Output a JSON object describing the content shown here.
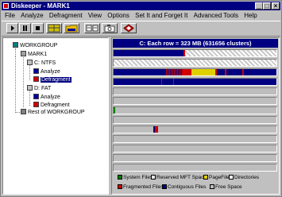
{
  "window": {
    "title": "Diskeeper - MARK1"
  },
  "title_buttons": {
    "minimize": "_",
    "maximize": "□",
    "close": "×"
  },
  "menu": [
    "File",
    "Analyze",
    "Defragment",
    "View",
    "Options",
    "Set It and Forget It",
    "Advanced Tools",
    "Help"
  ],
  "toolbar": {
    "buttons": [
      {
        "name": "play",
        "icon": "play-icon"
      },
      {
        "name": "pause",
        "icon": "pause-icon"
      },
      {
        "name": "stop",
        "icon": "stop-icon"
      },
      {
        "name": "grid",
        "icon": "grid-icon"
      },
      {
        "name": "folder",
        "icon": "folder-icon"
      },
      {
        "name": "volumes",
        "icon": "drives-icon"
      },
      {
        "name": "camera",
        "icon": "camera-icon"
      },
      {
        "name": "help",
        "icon": "diamond-icon"
      }
    ]
  },
  "tree": {
    "workgroup": "WORKGROUP",
    "computer": "MARK1",
    "drive_c": "C: NTFS",
    "c_analyze": "Analyze",
    "c_defragment": "Defragment",
    "drive_d": "D: FAT",
    "d_analyze": "Analyze",
    "d_defragment": "Defragment",
    "rest": "Rest of WORKGROUP"
  },
  "main": {
    "header": "C:  Each row = 323 MB (631656 clusters)"
  },
  "legend": {
    "system_files": "System Files",
    "reserved_mft": "Reserved MFT Space",
    "pagefile": "PageFile",
    "directories": "Directories",
    "fragmented": "Fragmented Files",
    "contiguous": "Contiguous Files",
    "free_space": "Free Space"
  },
  "colors": {
    "system": "#008000",
    "mft": "#e8e8e8",
    "pagefile": "#e0d000",
    "directories": "#ffffff",
    "fragmented": "#d00000",
    "contiguous": "#000080",
    "free": "#bdbdbd"
  }
}
